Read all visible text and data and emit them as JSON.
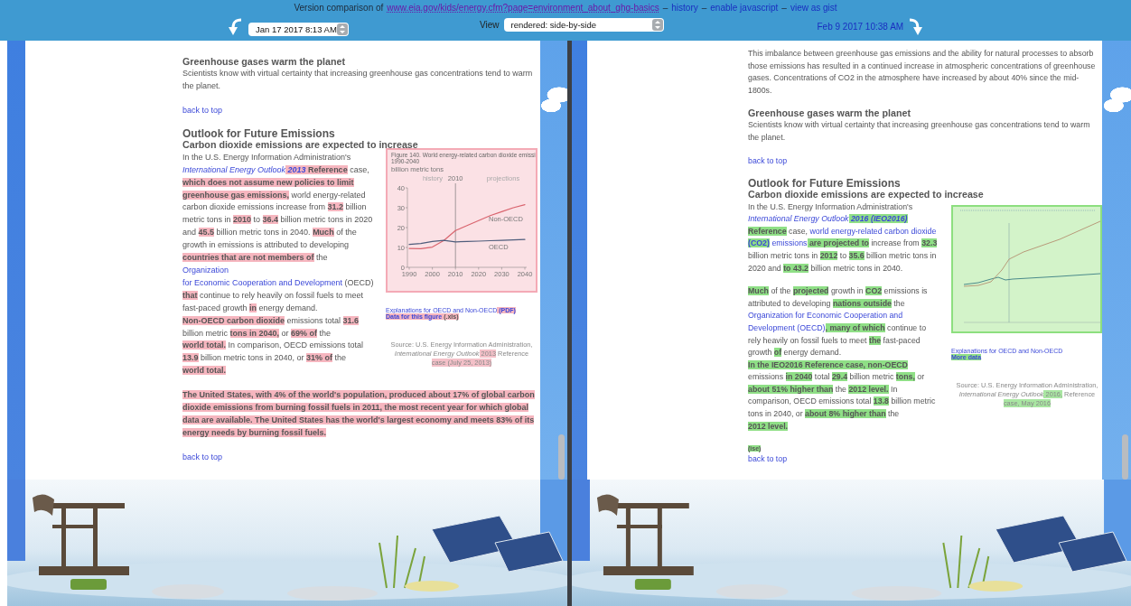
{
  "header": {
    "line": [
      {
        "kind": "text",
        "text": "Version comparison of"
      },
      {
        "kind": "url",
        "text": "www.eia.gov/kids/energy.cfm?page=environment_about_ghg-basics"
      },
      {
        "kind": "text",
        "text": "–"
      },
      {
        "kind": "link",
        "text": "history"
      },
      {
        "kind": "text",
        "text": "–"
      },
      {
        "kind": "link",
        "text": "enable javascript"
      },
      {
        "kind": "text",
        "text": "–"
      },
      {
        "kind": "link",
        "text": "view as gist"
      }
    ],
    "old_version": {
      "date": "Jan 17 2017 8:13 AM"
    },
    "view": {
      "label": "View",
      "value": "rendered: side-by-side"
    },
    "new_version": {
      "date": "Feb 9 2017 10:38 AM"
    }
  },
  "panels": [
    {
      "kind": "removed",
      "blocks": [
        {
          "kind": "heading",
          "text": "Greenhouse gases warm the planet"
        },
        {
          "kind": "paragraph",
          "segments": [
            {
              "kind": "text",
              "text": "Scientists know with virtual certainty that increasing greenhouse gas concentrations tend to warm the planet."
            }
          ]
        },
        {
          "kind": "back_link",
          "text": "back to top"
        },
        {
          "kind": "title",
          "text": "Outlook for Future Emissions"
        },
        {
          "kind": "subheading",
          "text": "Carbon dioxide emissions are expected to increase"
        },
        {
          "kind": "columns",
          "paragraphs": [
            {
              "segments": [
                {
                  "kind": "text",
                  "text": "In the U.S. Energy Information Administration's "
                },
                {
                  "kind": "italic_link",
                  "text": "International Energy Outlook"
                },
                {
                  "kind": "italic_link_change",
                  "text": " 2013"
                },
                {
                  "kind": "change",
                  "text": " Reference"
                },
                {
                  "kind": "text",
                  "text": " case, "
                },
                {
                  "kind": "change",
                  "text": "which does not assume new policies to limit "
                },
                {
                  "kind": "change",
                  "text": "greenhouse gas emissions,"
                },
                {
                  "kind": "text",
                  "text": " world energy-related carbon dioxide emissions increase from "
                },
                {
                  "kind": "change",
                  "text": "31.2"
                },
                {
                  "kind": "text",
                  "text": " billion metric tons in "
                },
                {
                  "kind": "change",
                  "text": "2010"
                },
                {
                  "kind": "text",
                  "text": " to "
                },
                {
                  "kind": "change",
                  "text": "36.4"
                },
                {
                  "kind": "text",
                  "text": " billion metric tons in 2020 and "
                },
                {
                  "kind": "change",
                  "text": "45.5"
                },
                {
                  "kind": "text",
                  "text": " billion metric tons in 2040. "
                },
                {
                  "kind": "change",
                  "text": "Much"
                },
                {
                  "kind": "text",
                  "text": " of the growth in emissions is attributed to developing "
                },
                {
                  "kind": "change",
                  "text": "countries that are not members of"
                },
                {
                  "kind": "text",
                  "text": " the "
                },
                {
                  "kind": "link",
                  "text": "Organization "
                },
                {
                  "kind": "link",
                  "text": "for Economic Cooperation and Development"
                },
                {
                  "kind": "text",
                  "text": " (OECD) "
                },
                {
                  "kind": "change",
                  "text": "that"
                },
                {
                  "kind": "text",
                  "text": " continue to rely heavily on fossil fuels to meet fast-paced growth "
                },
                {
                  "kind": "change",
                  "text": "in"
                },
                {
                  "kind": "text",
                  "text": " energy demand. "
                },
                {
                  "kind": "change",
                  "text": "Non-OECD carbon dioxide"
                },
                {
                  "kind": "text",
                  "text": " emissions total "
                },
                {
                  "kind": "change",
                  "text": "31.6"
                },
                {
                  "kind": "text",
                  "text": " billion metric "
                },
                {
                  "kind": "change",
                  "text": "tons in 2040,"
                },
                {
                  "kind": "text",
                  "text": " or "
                },
                {
                  "kind": "change",
                  "text": "69% of"
                },
                {
                  "kind": "text",
                  "text": " the "
                },
                {
                  "kind": "change",
                  "text": "world total."
                },
                {
                  "kind": "text",
                  "text": " In comparison, OECD emissions total "
                },
                {
                  "kind": "change",
                  "text": "13.9"
                },
                {
                  "kind": "text",
                  "text": " billion metric tons in 2040, or "
                },
                {
                  "kind": "change",
                  "text": "31% of"
                },
                {
                  "kind": "text",
                  "text": " the "
                },
                {
                  "kind": "change",
                  "text": "world total."
                }
              ]
            }
          ],
          "figure": {
            "chart_data": {
              "type": "line",
              "title": "Figure 140. World energy-related carbon dioxide emissi",
              "ylabel": "billion metric tons",
              "x": [
                1990,
                1995,
                2000,
                2005,
                2010,
                2015,
                2020,
                2025,
                2030,
                2035,
                2040
              ],
              "series": [
                {
                  "name": "Non-OECD",
                  "color": "#d9646e",
                  "values": [
                    9.5,
                    9.4,
                    10.2,
                    13.5,
                    18.5,
                    21,
                    23.5,
                    26,
                    28,
                    30,
                    31.5
                  ]
                },
                {
                  "name": "OECD",
                  "color": "#4f5d7c",
                  "values": [
                    11.5,
                    12,
                    13,
                    13.6,
                    12.8,
                    13,
                    13.2,
                    13.4,
                    13.6,
                    13.8,
                    14
                  ]
                }
              ],
              "xlim": [
                1990,
                2040
              ],
              "ylim": [
                0,
                40
              ],
              "xticks": [
                1990,
                2000,
                2010,
                2020,
                2030,
                2040
              ],
              "yticks": [
                0,
                10,
                20,
                30,
                40
              ],
              "annotations": [
                "1990-2040",
                "history",
                "2010",
                "projections"
              ]
            },
            "links": [
              [
                {
                  "kind": "link",
                  "text": "Explanations for OECD and Non-OECD"
                },
                {
                  "kind": "link_change",
                  "text": " (PDF)"
                }
              ],
              [
                {
                  "kind": "link_change",
                  "text": "Data for this figure"
                },
                {
                  "kind": "change",
                  "text": " (.xls)"
                }
              ]
            ],
            "source": [
              {
                "kind": "text",
                "text": "Source: U.S. Energy Information Administration, "
              },
              {
                "kind": "italic",
                "text": "International Energy Outlook"
              },
              {
                "kind": "soft_change",
                "text": " 2013"
              },
              {
                "kind": "text",
                "text": " Reference"
              },
              {
                "kind": "soft_change",
                "text": " case (July 25, 2013)"
              }
            ]
          }
        },
        {
          "kind": "changed_paragraph",
          "text": "The United States, with 4% of the world's population, produced about 17% of global carbon dioxide emissions from burning fossil fuels in 2011, the most recent year for which global data are available. The United States has the world's largest economy and meets 83% of its energy needs by burning fossil fuels."
        },
        {
          "kind": "back_link",
          "text": "back to top"
        }
      ]
    },
    {
      "kind": "added",
      "blocks": [
        {
          "kind": "paragraph",
          "segments": [
            {
              "kind": "text",
              "text": "This imbalance between greenhouse gas emissions and the ability for natural processes to absorb those emissions has resulted in a continued increase in atmospheric concentrations of greenhouse gases. Concentrations of CO2 in the atmosphere have increased by about 40% since the mid-1800s."
            }
          ]
        },
        {
          "kind": "heading",
          "text": "Greenhouse gases warm the planet"
        },
        {
          "kind": "paragraph",
          "segments": [
            {
              "kind": "text",
              "text": "Scientists know with virtual certainty that increasing greenhouse gas concentrations tend to warm the planet."
            }
          ]
        },
        {
          "kind": "back_link",
          "text": "back to top"
        },
        {
          "kind": "title",
          "text": "Outlook for Future Emissions"
        },
        {
          "kind": "subheading",
          "text": "Carbon dioxide emissions are expected to increase"
        },
        {
          "kind": "columns",
          "paragraphs": [
            {
              "segments": [
                {
                  "kind": "text",
                  "text": "In the U.S. Energy Information Administration's "
                },
                {
                  "kind": "italic_link",
                  "text": "International Energy Outlook"
                },
                {
                  "kind": "italic_link_change",
                  "text": " 2016 (IEO2016) "
                },
                {
                  "kind": "change",
                  "text": "Reference"
                },
                {
                  "kind": "text",
                  "text": " case, "
                },
                {
                  "kind": "link",
                  "text": "world energy-related carbon dioxide "
                },
                {
                  "kind": "link_change",
                  "text": "(CO2)"
                },
                {
                  "kind": "link",
                  "text": " emissions"
                },
                {
                  "kind": "change",
                  "text": " are projected to"
                },
                {
                  "kind": "text",
                  "text": " increase from "
                },
                {
                  "kind": "change",
                  "text": "32.3"
                },
                {
                  "kind": "text",
                  "text": " billion metric tons in "
                },
                {
                  "kind": "change",
                  "text": "2012"
                },
                {
                  "kind": "text",
                  "text": " to "
                },
                {
                  "kind": "change",
                  "text": "35.6"
                },
                {
                  "kind": "text",
                  "text": " billion metric tons in 2020 and "
                },
                {
                  "kind": "change",
                  "text": "to 43.2"
                },
                {
                  "kind": "text",
                  "text": " billion metric tons in 2040."
                }
              ]
            },
            {
              "segments": [
                {
                  "kind": "change",
                  "text": "Much"
                },
                {
                  "kind": "text",
                  "text": " of the "
                },
                {
                  "kind": "change",
                  "text": "projected"
                },
                {
                  "kind": "text",
                  "text": " growth in "
                },
                {
                  "kind": "change",
                  "text": "CO2"
                },
                {
                  "kind": "text",
                  "text": " emissions is attributed to developing "
                },
                {
                  "kind": "change",
                  "text": "nations outside"
                },
                {
                  "kind": "text",
                  "text": " the "
                },
                {
                  "kind": "link",
                  "text": "Organization for Economic Cooperation and "
                },
                {
                  "kind": "link",
                  "text": "Development (OECD)"
                },
                {
                  "kind": "change",
                  "text": ", many of which"
                },
                {
                  "kind": "text",
                  "text": " continue to rely heavily on fossil fuels to meet "
                },
                {
                  "kind": "change",
                  "text": "the"
                },
                {
                  "kind": "text",
                  "text": " fast-paced growth "
                },
                {
                  "kind": "change",
                  "text": "of"
                },
                {
                  "kind": "text",
                  "text": " energy demand. "
                },
                {
                  "kind": "change",
                  "text": "In the IEO2016 Reference case, non-OECD"
                },
                {
                  "kind": "text",
                  "text": " emissions "
                },
                {
                  "kind": "change",
                  "text": "in 2040"
                },
                {
                  "kind": "text",
                  "text": " total "
                },
                {
                  "kind": "change",
                  "text": "29.4"
                },
                {
                  "kind": "text",
                  "text": " billion metric "
                },
                {
                  "kind": "change",
                  "text": "tons,"
                },
                {
                  "kind": "text",
                  "text": " or "
                },
                {
                  "kind": "change",
                  "text": "about 51% higher than"
                },
                {
                  "kind": "text",
                  "text": " the "
                },
                {
                  "kind": "change",
                  "text": "2012 level."
                },
                {
                  "kind": "text",
                  "text": " In comparison, OECD emissions total "
                },
                {
                  "kind": "change",
                  "text": "13.8"
                },
                {
                  "kind": "text",
                  "text": " billion metric tons in 2040, or "
                },
                {
                  "kind": "change",
                  "text": "about 8% higher than"
                },
                {
                  "kind": "text",
                  "text": " the "
                },
                {
                  "kind": "change",
                  "text": "2012 level."
                }
              ]
            }
          ],
          "figure": {
            "links": [
              [
                {
                  "kind": "link",
                  "text": "Explanations for OECD and Non-OECD"
                }
              ],
              [
                {
                  "kind": "link_change",
                  "text": "More data"
                }
              ]
            ],
            "source": [
              {
                "kind": "text",
                "text": "Source: U.S. Energy Information Administration, "
              },
              {
                "kind": "italic",
                "text": "International Energy Outlook"
              },
              {
                "kind": "soft_change",
                "text": " 2016,"
              },
              {
                "kind": "text",
                "text": " Reference"
              },
              {
                "kind": "soft_change",
                "text": " case, May 2016"
              }
            ]
          }
        },
        {
          "kind": "note",
          "text": "(ise)"
        },
        {
          "kind": "back_link",
          "text": "back to top"
        }
      ]
    }
  ]
}
